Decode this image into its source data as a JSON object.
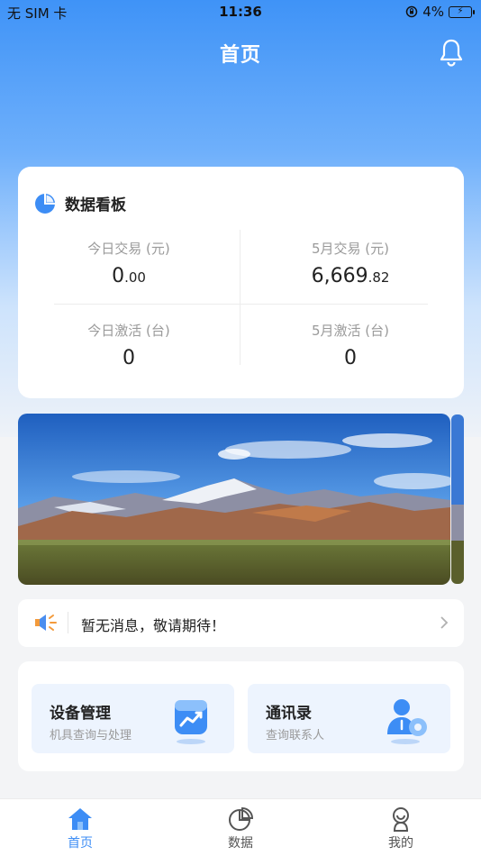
{
  "status_bar": {
    "carrier": "无 SIM 卡",
    "time": "11:36",
    "battery_pct": "4%"
  },
  "header": {
    "title": "首页",
    "icon": "bell-icon"
  },
  "dashboard": {
    "title": "数据看板",
    "icon": "pie-chart-icon",
    "stats": [
      {
        "label": "今日交易 (元)",
        "value_int": "0",
        "value_dec": ".00"
      },
      {
        "label": "5月交易 (元)",
        "value_int": "6,669",
        "value_dec": ".82"
      },
      {
        "label": "今日激活 (台)",
        "value_int": "0",
        "value_dec": ""
      },
      {
        "label": "5月激活 (台)",
        "value_int": "0",
        "value_dec": ""
      }
    ]
  },
  "notice": {
    "icon": "speaker-icon",
    "text": "暂无消息，敬请期待！"
  },
  "services": [
    {
      "title": "设备管理",
      "subtitle": "机具查询与处理",
      "icon": "device-chart-icon"
    },
    {
      "title": "通讯录",
      "subtitle": "查询联系人",
      "icon": "contact-gear-icon"
    }
  ],
  "tabs": [
    {
      "label": "首页",
      "icon": "home-icon",
      "active": true
    },
    {
      "label": "数据",
      "icon": "pie-chart-icon",
      "active": false
    },
    {
      "label": "我的",
      "icon": "profile-icon",
      "active": false
    }
  ],
  "colors": {
    "accent": "#3d8df5",
    "tab_inactive": "#555555"
  }
}
